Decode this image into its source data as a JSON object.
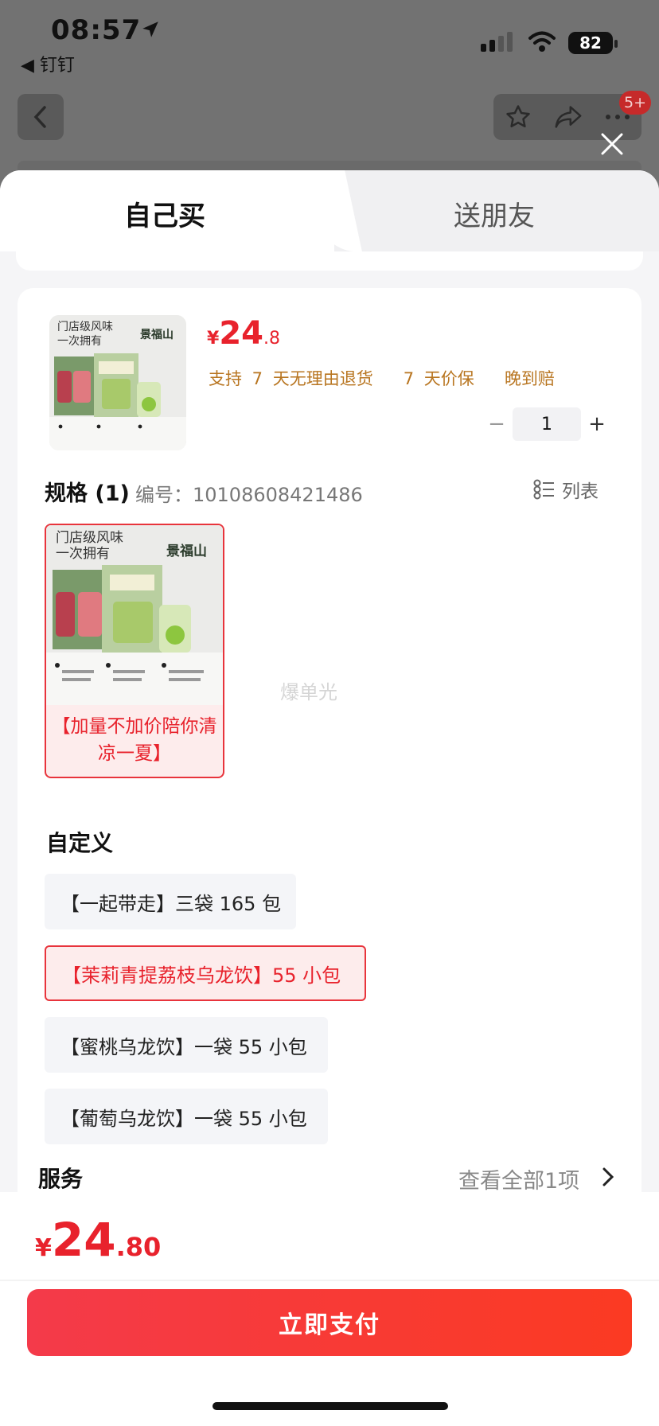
{
  "status_bar": {
    "time": "08:57",
    "back_app": "◀ 钉钉",
    "battery": "82"
  },
  "nav": {
    "badge": "5+"
  },
  "tabs": [
    {
      "label": "自己买",
      "active": true
    },
    {
      "label": "送朋友",
      "active": false
    }
  ],
  "product": {
    "thumb_text": "门店级风味\n一次拥有",
    "thumb_brand": "景福山",
    "price": {
      "currency": "¥",
      "integer": "24",
      "decimal": ".8"
    },
    "service_tags": [
      "支持 7 天无理由退货",
      "7 天价保",
      "晚到赔"
    ],
    "quantity": "1",
    "qty_minus": "−",
    "qty_plus": "+"
  },
  "spec": {
    "title": "规格 (1)",
    "code": "编号：10108608421486",
    "list_toggle": "列表",
    "selected_label": "【加量不加价陪你清凉一夏】",
    "watermark": "爆单光"
  },
  "custom": {
    "title": "自定义",
    "options": [
      {
        "label": "【一起带走】三袋 165 包",
        "selected": false
      },
      {
        "label": "【茉莉青提荔枝乌龙饮】55 小包",
        "selected": true
      },
      {
        "label": "【蜜桃乌龙饮】一袋 55 小包",
        "selected": false
      },
      {
        "label": "【葡萄乌龙饮】一袋 55 小包",
        "selected": false
      }
    ]
  },
  "service": {
    "title": "服务",
    "more": "查看全部1项"
  },
  "footer": {
    "price": {
      "currency": "¥",
      "integer": "24",
      "decimal": ".80"
    },
    "pay_label": "立即支付"
  },
  "colors": {
    "accent": "#e8222c",
    "tag": "#b87520",
    "pay_start": "#f43a4a",
    "pay_end": "#fb3a22"
  }
}
